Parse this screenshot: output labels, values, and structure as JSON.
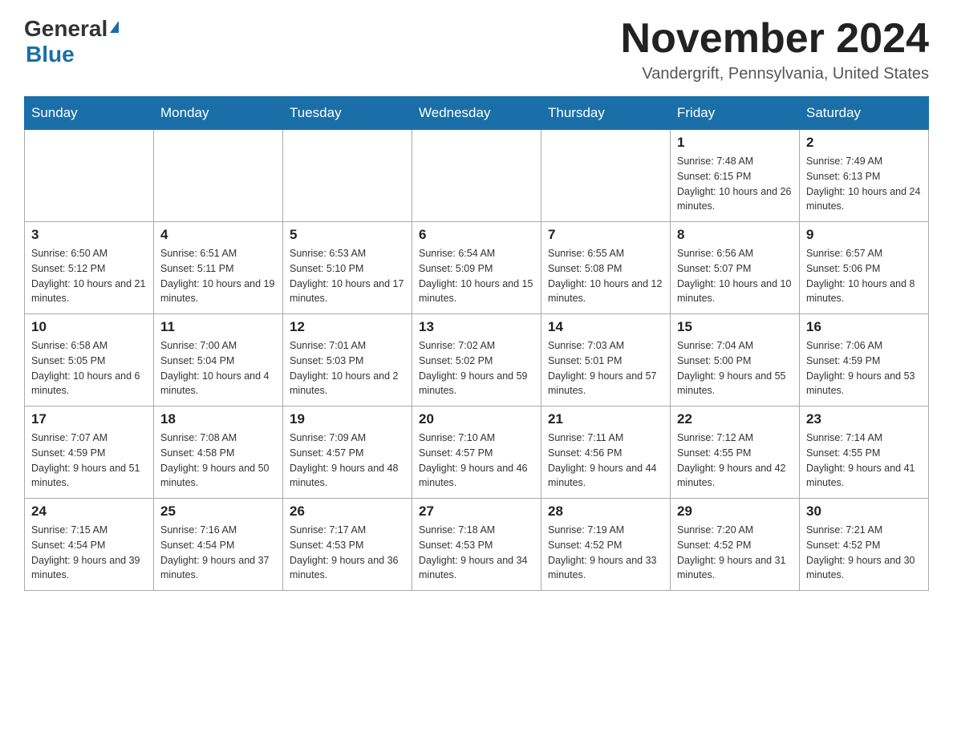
{
  "header": {
    "logo_general": "General",
    "logo_blue": "Blue",
    "month_title": "November 2024",
    "location": "Vandergrift, Pennsylvania, United States"
  },
  "weekdays": [
    "Sunday",
    "Monday",
    "Tuesday",
    "Wednesday",
    "Thursday",
    "Friday",
    "Saturday"
  ],
  "weeks": [
    [
      {
        "day": "",
        "info": ""
      },
      {
        "day": "",
        "info": ""
      },
      {
        "day": "",
        "info": ""
      },
      {
        "day": "",
        "info": ""
      },
      {
        "day": "",
        "info": ""
      },
      {
        "day": "1",
        "info": "Sunrise: 7:48 AM\nSunset: 6:15 PM\nDaylight: 10 hours and 26 minutes."
      },
      {
        "day": "2",
        "info": "Sunrise: 7:49 AM\nSunset: 6:13 PM\nDaylight: 10 hours and 24 minutes."
      }
    ],
    [
      {
        "day": "3",
        "info": "Sunrise: 6:50 AM\nSunset: 5:12 PM\nDaylight: 10 hours and 21 minutes."
      },
      {
        "day": "4",
        "info": "Sunrise: 6:51 AM\nSunset: 5:11 PM\nDaylight: 10 hours and 19 minutes."
      },
      {
        "day": "5",
        "info": "Sunrise: 6:53 AM\nSunset: 5:10 PM\nDaylight: 10 hours and 17 minutes."
      },
      {
        "day": "6",
        "info": "Sunrise: 6:54 AM\nSunset: 5:09 PM\nDaylight: 10 hours and 15 minutes."
      },
      {
        "day": "7",
        "info": "Sunrise: 6:55 AM\nSunset: 5:08 PM\nDaylight: 10 hours and 12 minutes."
      },
      {
        "day": "8",
        "info": "Sunrise: 6:56 AM\nSunset: 5:07 PM\nDaylight: 10 hours and 10 minutes."
      },
      {
        "day": "9",
        "info": "Sunrise: 6:57 AM\nSunset: 5:06 PM\nDaylight: 10 hours and 8 minutes."
      }
    ],
    [
      {
        "day": "10",
        "info": "Sunrise: 6:58 AM\nSunset: 5:05 PM\nDaylight: 10 hours and 6 minutes."
      },
      {
        "day": "11",
        "info": "Sunrise: 7:00 AM\nSunset: 5:04 PM\nDaylight: 10 hours and 4 minutes."
      },
      {
        "day": "12",
        "info": "Sunrise: 7:01 AM\nSunset: 5:03 PM\nDaylight: 10 hours and 2 minutes."
      },
      {
        "day": "13",
        "info": "Sunrise: 7:02 AM\nSunset: 5:02 PM\nDaylight: 9 hours and 59 minutes."
      },
      {
        "day": "14",
        "info": "Sunrise: 7:03 AM\nSunset: 5:01 PM\nDaylight: 9 hours and 57 minutes."
      },
      {
        "day": "15",
        "info": "Sunrise: 7:04 AM\nSunset: 5:00 PM\nDaylight: 9 hours and 55 minutes."
      },
      {
        "day": "16",
        "info": "Sunrise: 7:06 AM\nSunset: 4:59 PM\nDaylight: 9 hours and 53 minutes."
      }
    ],
    [
      {
        "day": "17",
        "info": "Sunrise: 7:07 AM\nSunset: 4:59 PM\nDaylight: 9 hours and 51 minutes."
      },
      {
        "day": "18",
        "info": "Sunrise: 7:08 AM\nSunset: 4:58 PM\nDaylight: 9 hours and 50 minutes."
      },
      {
        "day": "19",
        "info": "Sunrise: 7:09 AM\nSunset: 4:57 PM\nDaylight: 9 hours and 48 minutes."
      },
      {
        "day": "20",
        "info": "Sunrise: 7:10 AM\nSunset: 4:57 PM\nDaylight: 9 hours and 46 minutes."
      },
      {
        "day": "21",
        "info": "Sunrise: 7:11 AM\nSunset: 4:56 PM\nDaylight: 9 hours and 44 minutes."
      },
      {
        "day": "22",
        "info": "Sunrise: 7:12 AM\nSunset: 4:55 PM\nDaylight: 9 hours and 42 minutes."
      },
      {
        "day": "23",
        "info": "Sunrise: 7:14 AM\nSunset: 4:55 PM\nDaylight: 9 hours and 41 minutes."
      }
    ],
    [
      {
        "day": "24",
        "info": "Sunrise: 7:15 AM\nSunset: 4:54 PM\nDaylight: 9 hours and 39 minutes."
      },
      {
        "day": "25",
        "info": "Sunrise: 7:16 AM\nSunset: 4:54 PM\nDaylight: 9 hours and 37 minutes."
      },
      {
        "day": "26",
        "info": "Sunrise: 7:17 AM\nSunset: 4:53 PM\nDaylight: 9 hours and 36 minutes."
      },
      {
        "day": "27",
        "info": "Sunrise: 7:18 AM\nSunset: 4:53 PM\nDaylight: 9 hours and 34 minutes."
      },
      {
        "day": "28",
        "info": "Sunrise: 7:19 AM\nSunset: 4:52 PM\nDaylight: 9 hours and 33 minutes."
      },
      {
        "day": "29",
        "info": "Sunrise: 7:20 AM\nSunset: 4:52 PM\nDaylight: 9 hours and 31 minutes."
      },
      {
        "day": "30",
        "info": "Sunrise: 7:21 AM\nSunset: 4:52 PM\nDaylight: 9 hours and 30 minutes."
      }
    ]
  ]
}
